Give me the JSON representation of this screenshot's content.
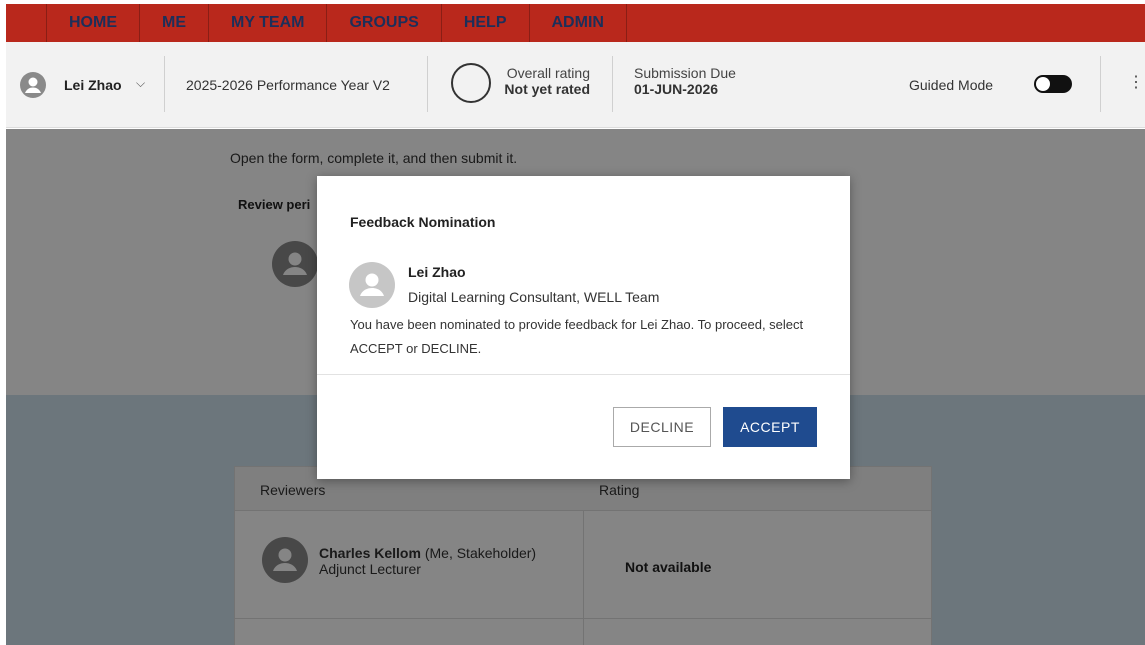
{
  "nav": {
    "items": [
      {
        "label": "HOME"
      },
      {
        "label": "ME"
      },
      {
        "label": "MY TEAM"
      },
      {
        "label": "GROUPS"
      },
      {
        "label": "HELP"
      },
      {
        "label": "ADMIN"
      }
    ]
  },
  "header": {
    "user_name": "Lei Zhao",
    "performance_year": "2025-2026 Performance Year V2",
    "overall_rating_label": "Overall rating",
    "overall_rating_value": "Not yet rated",
    "submission_due_label": "Submission Due",
    "submission_due_value": "01-JUN-2026",
    "guided_mode_label": "Guided Mode",
    "guided_mode_on": false
  },
  "content": {
    "instruction": "Open the form, complete it, and then submit it.",
    "review_period_label": "Review peri"
  },
  "reviewers_table": {
    "headers": [
      "Reviewers",
      "Rating"
    ],
    "rows": [
      {
        "name": "Charles Kellom",
        "relation": " (Me, Stakeholder)",
        "title": "Adjunct Lecturer",
        "rating": "Not available"
      }
    ]
  },
  "modal": {
    "title": "Feedback Nomination",
    "person_name": "Lei Zhao",
    "person_role": "Digital Learning Consultant, WELL Team",
    "message": "You have been nominated to provide feedback for Lei Zhao. To proceed, select ACCEPT or DECLINE.",
    "decline_label": "DECLINE",
    "accept_label": "ACCEPT"
  },
  "colors": {
    "nav_bg": "#b9281c",
    "nav_text": "#1c2f5a",
    "accept_bg": "#1f4b8f"
  }
}
